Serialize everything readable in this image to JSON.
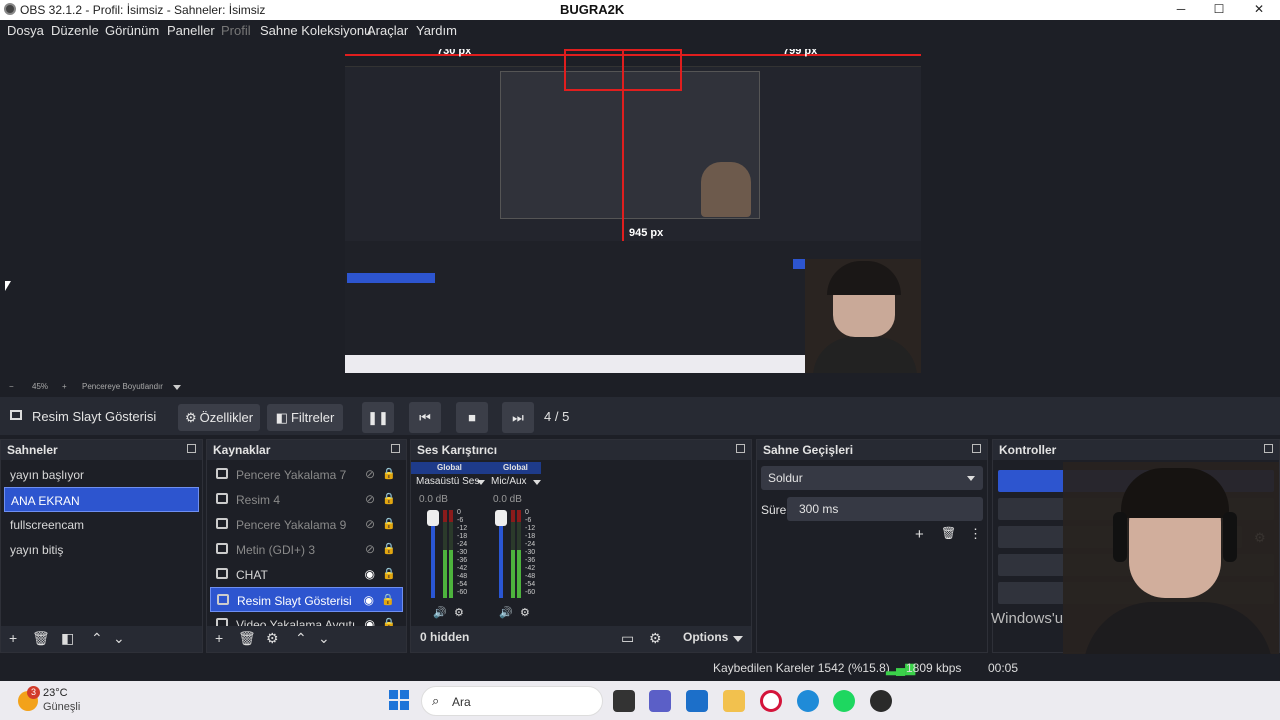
{
  "window": {
    "title": "OBS 32.1.2 - Profil: İsimsiz - Sahneler: İsimsiz",
    "watermark": "BUGRA2K",
    "min": "─",
    "max": "☐",
    "close": "✕"
  },
  "menu": [
    "Dosya",
    "Düzenle",
    "Görünüm",
    "Paneller",
    "Profil",
    "Sahne Koleksiyonu",
    "Araçlar",
    "Yardım"
  ],
  "preview": {
    "measure_top_left": "730 px",
    "measure_top_right": "799 px",
    "measure_mid": "945 px"
  },
  "zoom": {
    "minus": "−",
    "level": "45%",
    "plus": "+",
    "fit_label": "Pencereye Boyutlandır"
  },
  "source_toolbar": {
    "source_name": "Resim Slayt Gösterisi",
    "properties": "Özellikler",
    "filters": "Filtreler",
    "counter": "4  /  5"
  },
  "scenes": {
    "title": "Sahneler",
    "items": [
      "yayın başlıyor",
      "ANA EKRAN",
      "fullscreencam",
      "yayın bitiş"
    ],
    "selected": 1
  },
  "sources": {
    "title": "Kaynaklar",
    "items": [
      {
        "label": "Pencere Yakalama 7",
        "icon": "window-icon",
        "visible": false
      },
      {
        "label": "Resim 4",
        "icon": "image-icon",
        "visible": false
      },
      {
        "label": "Pencere Yakalama 9",
        "icon": "window-icon",
        "visible": false
      },
      {
        "label": "Metin (GDI+) 3",
        "icon": "text-icon",
        "visible": false
      },
      {
        "label": "CHAT",
        "icon": "browser-icon",
        "visible": true
      },
      {
        "label": "Resim Slayt Gösterisi",
        "icon": "slideshow-icon",
        "visible": true
      },
      {
        "label": "Video Yakalama Aygıtı",
        "icon": "camera-icon",
        "visible": true
      }
    ]
  },
  "mixer": {
    "title": "Ses Karıştırıcı",
    "channels": [
      {
        "badge": "Global",
        "name": "Masaüstü Ses",
        "db": "0.0 dB",
        "level": 0.55
      },
      {
        "badge": "Global",
        "name": "Mic/Aux",
        "db": "0.0 dB",
        "level": 0.55
      }
    ],
    "scale": [
      "0",
      "-6",
      "-12",
      "-18",
      "-24",
      "-30",
      "-36",
      "-42",
      "-48",
      "-54",
      "-60"
    ],
    "hidden": "0 hidden",
    "options": "Options"
  },
  "transitions": {
    "title": "Sahne Geçişleri",
    "type": "Soldur",
    "duration_label": "Süre",
    "duration": "300 ms"
  },
  "controls": {
    "title": "Kontroller",
    "windows_text": "Windows'u"
  },
  "status": {
    "dropped": "Kaybedilen Kareler 1542 (%15.8)",
    "bitrate": "1809 kbps",
    "time": "00:05"
  },
  "taskbar": {
    "weather_temp": "23°C",
    "weather_desc": "Güneşli",
    "search": "Ara",
    "badge": "3"
  }
}
